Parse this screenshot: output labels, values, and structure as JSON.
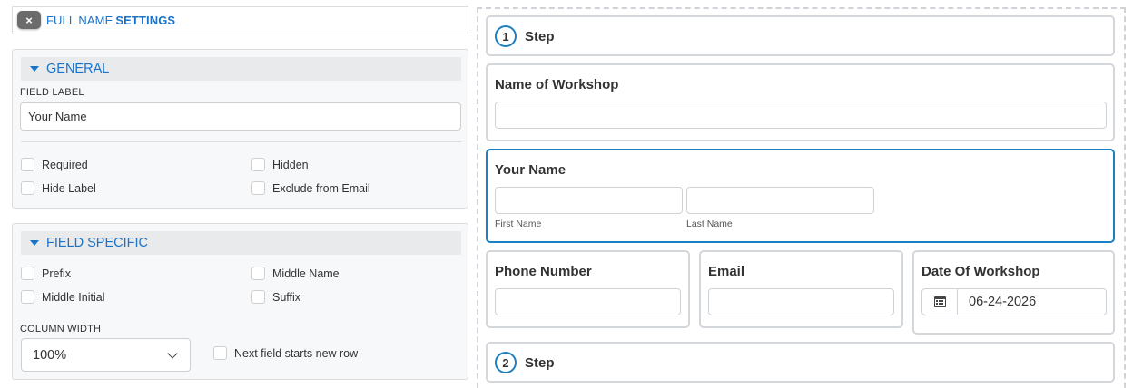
{
  "settings": {
    "close_label": "×",
    "title_prefix": "FULL NAME",
    "title_suffix": "SETTINGS"
  },
  "general": {
    "heading": "GENERAL",
    "field_label_caption": "FIELD LABEL",
    "field_label_value": "Your Name",
    "checkboxes": [
      "Required",
      "Hidden",
      "Hide Label",
      "Exclude from Email"
    ]
  },
  "field_specific": {
    "heading": "FIELD SPECIFIC",
    "checkboxes": [
      "Prefix",
      "Middle Name",
      "Middle Initial",
      "Suffix"
    ],
    "column_width_caption": "COLUMN WIDTH",
    "column_width_value": "100%",
    "new_row_label": "Next field starts new row"
  },
  "form": {
    "step1": {
      "number": "1",
      "label": "Step"
    },
    "workshop_name": {
      "label": "Name of Workshop",
      "value": ""
    },
    "your_name": {
      "label": "Your Name",
      "first_caption": "First Name",
      "last_caption": "Last Name"
    },
    "phone": {
      "label": "Phone Number"
    },
    "email": {
      "label": "Email"
    },
    "date": {
      "label": "Date Of Workshop",
      "value": "06-24-2026"
    },
    "step2": {
      "number": "2",
      "label": "Step"
    }
  },
  "colors": {
    "accent": "#1a73c8",
    "active_border": "#1b7fc4",
    "panel_bg": "#f7f8fa",
    "border": "#d3d6da"
  }
}
